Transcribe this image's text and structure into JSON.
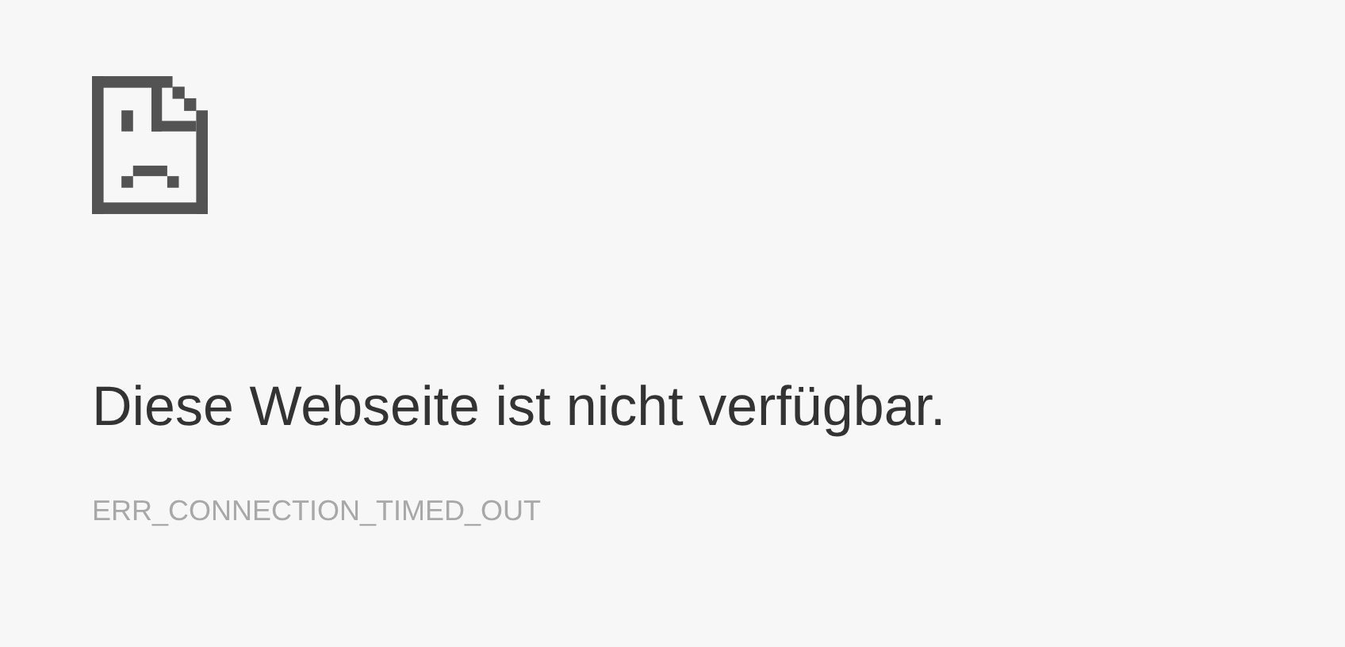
{
  "heading": "Diese Webseite ist nicht verfügbar.",
  "error_code": "ERR_CONNECTION_TIMED_OUT"
}
